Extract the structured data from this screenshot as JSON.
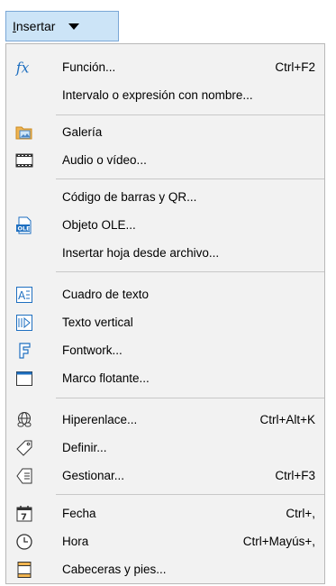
{
  "menu_button": {
    "label": "Insertar"
  },
  "items": [
    {
      "label": "Función...",
      "accel": "Ctrl+F2",
      "icon": "function-icon"
    },
    {
      "label": "Intervalo o expresión con nombre...",
      "accel": "",
      "icon": ""
    },
    {
      "label": "Galería",
      "accel": "",
      "icon": "gallery-icon"
    },
    {
      "label": "Audio o vídeo...",
      "accel": "",
      "icon": "media-icon"
    },
    {
      "label": "Código de barras y QR...",
      "accel": "",
      "icon": ""
    },
    {
      "label": "Objeto OLE...",
      "accel": "",
      "icon": "ole-icon"
    },
    {
      "label": "Insertar hoja desde archivo...",
      "accel": "",
      "icon": ""
    },
    {
      "label": "Cuadro de texto",
      "accel": "",
      "icon": "text-box-icon"
    },
    {
      "label": "Texto vertical",
      "accel": "",
      "icon": "vertical-text-icon"
    },
    {
      "label": "Fontwork...",
      "accel": "",
      "icon": "fontwork-icon"
    },
    {
      "label": "Marco flotante...",
      "accel": "",
      "icon": "floating-frame-icon"
    },
    {
      "label": "Hiperenlace...",
      "accel": "Ctrl+Alt+K",
      "icon": "hyperlink-icon"
    },
    {
      "label": "Definir...",
      "accel": "",
      "icon": "tag-icon"
    },
    {
      "label": "Gestionar...",
      "accel": "Ctrl+F3",
      "icon": "manage-names-icon"
    },
    {
      "label": "Fecha",
      "accel": "Ctrl+,",
      "icon": "calendar-icon"
    },
    {
      "label": "Hora",
      "accel": "Ctrl+Mayús+,",
      "icon": "clock-icon"
    },
    {
      "label": "Cabeceras y pies...",
      "accel": "",
      "icon": "header-footer-icon"
    }
  ]
}
